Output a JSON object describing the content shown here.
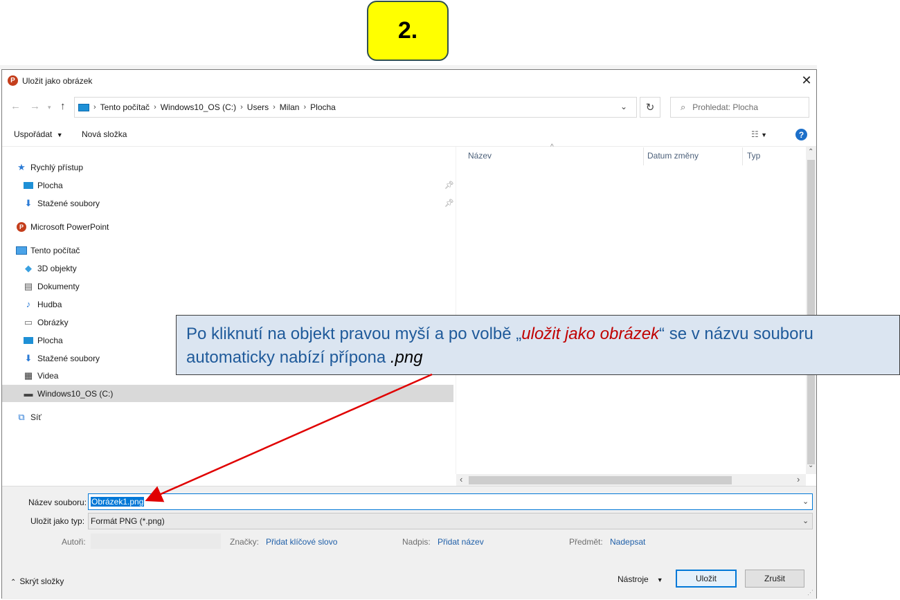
{
  "badge": "2.",
  "dialog": {
    "title": "Uložit jako obrázek",
    "app_icon_letter": "P",
    "address": {
      "crumbs": [
        "Tento počítač",
        "Windows10_OS (C:)",
        "Users",
        "Milan",
        "Plocha"
      ]
    },
    "search_placeholder": "Prohledat: Plocha",
    "toolbar": {
      "organize": "Uspořádat",
      "new_folder": "Nová složka",
      "help": "?"
    },
    "nav": {
      "quick_access": "Rychlý přístup",
      "qa_items": [
        "Plocha",
        "Stažené soubory"
      ],
      "powerpoint": "Microsoft PowerPoint",
      "this_pc": "Tento počítač",
      "pc_items": [
        "3D objekty",
        "Dokumenty",
        "Hudba",
        "Obrázky",
        "Plocha",
        "Stažené soubory",
        "Videa",
        "Windows10_OS (C:)"
      ],
      "network": "Síť"
    },
    "columns": [
      "Název",
      "Datum změny",
      "Typ"
    ],
    "file_name_label": "Název souboru:",
    "file_name_value": "Obrázek1.png",
    "save_type_label": "Uložit jako typ:",
    "save_type_value": "Formát PNG (*.png)",
    "meta": {
      "authors_label": "Autoři:",
      "tags_label": "Značky:",
      "tags_value": "Přidat klíčové slovo",
      "title_label": "Nadpis:",
      "title_value": "Přidat název",
      "subject_label": "Předmět:",
      "subject_value": "Nadepsat"
    },
    "hide_folders": "Skrýt složky",
    "tools": "Nástroje",
    "save": "Uložit",
    "cancel": "Zrušit"
  },
  "callout": {
    "text_before": "Po kliknutí na objekt pravou myší a po volbě „",
    "highlight": "uložit jako obrázek",
    "text_middle": "“ se v názvu souboru automaticky nabízí přípona ",
    "extension": ".png"
  },
  "colors": {
    "badge": "#ffff00",
    "callout_bg": "#dbe5f1",
    "callout_text": "#1f5a9a",
    "highlight": "#c00000",
    "arrow": "#e00000"
  }
}
